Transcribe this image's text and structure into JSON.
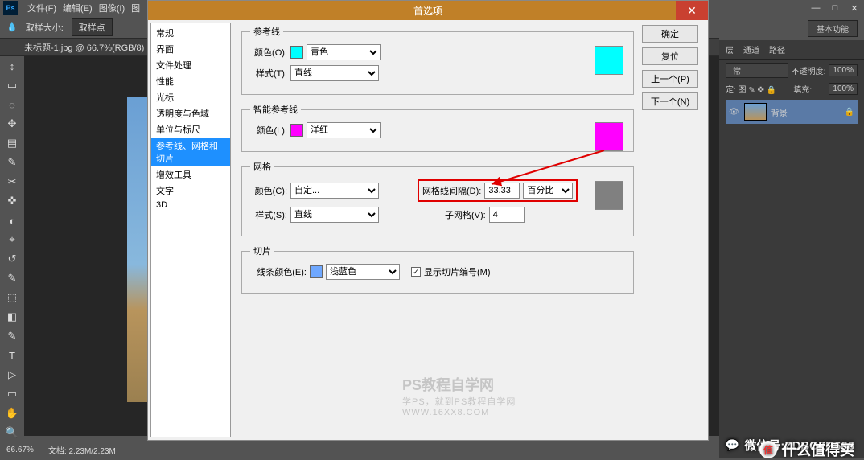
{
  "app": {
    "logo": "Ps"
  },
  "menubar": [
    "文件(F)",
    "编辑(E)",
    "图像(I)",
    "图"
  ],
  "windowControls": {
    "min": "—",
    "max": "□",
    "close": "✕"
  },
  "optionsBar": {
    "sizeLabel": "取样大小:",
    "sizeValue": "取样点"
  },
  "workspaceBtn": "基本功能",
  "docTab": "未标题-1.jpg @ 66.7%(RGB/8)",
  "statusBar": {
    "zoom": "66.67%",
    "docInfo": "文档: 2.23M/2.23M"
  },
  "panels": {
    "tabs1": [
      "层",
      "通道",
      "路径"
    ],
    "blendMode": "常",
    "opacityLabel": "不透明度:",
    "opacityValue": "100%",
    "lockRow": "定: 图 ✎ ✜ 🔒",
    "fillLabel": "填充:",
    "fillValue": "100%",
    "layerName": "背景",
    "lockIcon": "🔒"
  },
  "dialog": {
    "title": "首选项",
    "sidebar": [
      "常规",
      "界面",
      "文件处理",
      "性能",
      "光标",
      "透明度与色域",
      "单位与标尺",
      "参考线、网格和切片",
      "增效工具",
      "文字",
      "3D"
    ],
    "sidebarSelectedIndex": 7,
    "buttons": {
      "ok": "确定",
      "reset": "复位",
      "prev": "上一个(P)",
      "next": "下一个(N)"
    },
    "guides": {
      "legend": "参考线",
      "colorLabel": "颜色(O):",
      "colorValue": "青色",
      "colorHex": "#00ffff",
      "styleLabel": "样式(T):",
      "styleValue": "直线"
    },
    "smartGuides": {
      "legend": "智能参考线",
      "colorLabel": "颜色(L):",
      "colorValue": "洋红",
      "colorHex": "#ff00ff"
    },
    "grid": {
      "legend": "网格",
      "colorLabel": "颜色(C):",
      "colorValue": "自定...",
      "colorHex": "#808080",
      "styleLabel": "样式(S):",
      "styleValue": "直线",
      "gridlineLabel": "网格线间隔(D):",
      "gridlineValue": "33.33",
      "gridlineUnit": "百分比",
      "subdivLabel": "子网格(V):",
      "subdivValue": "4"
    },
    "slices": {
      "legend": "切片",
      "lineColorLabel": "线条颜色(E):",
      "lineColorValue": "浅蓝色",
      "swatchHex": "#6fa8ff",
      "showNumbersLabel": "显示切片编号(M)"
    }
  },
  "watermarkLeft": {
    "title": "PS教程自学网",
    "line2": "学PS，就到PS教程自学网",
    "url": "WWW.16XX8.COM"
  },
  "watermarkRight": {
    "wechat": "微信号:ZDBCZB666",
    "brand": "什么值得买",
    "badge": "值"
  },
  "tools": [
    "↕",
    "▭",
    "◌",
    "✥",
    "▤",
    "✎",
    "✂",
    "✜",
    "◐",
    "⌖",
    "↺",
    "✎",
    "⬚",
    "◧",
    "✎",
    "✎",
    "T",
    "▷",
    "▭",
    "✋",
    "🔍",
    "■",
    "⇆",
    "▣"
  ]
}
